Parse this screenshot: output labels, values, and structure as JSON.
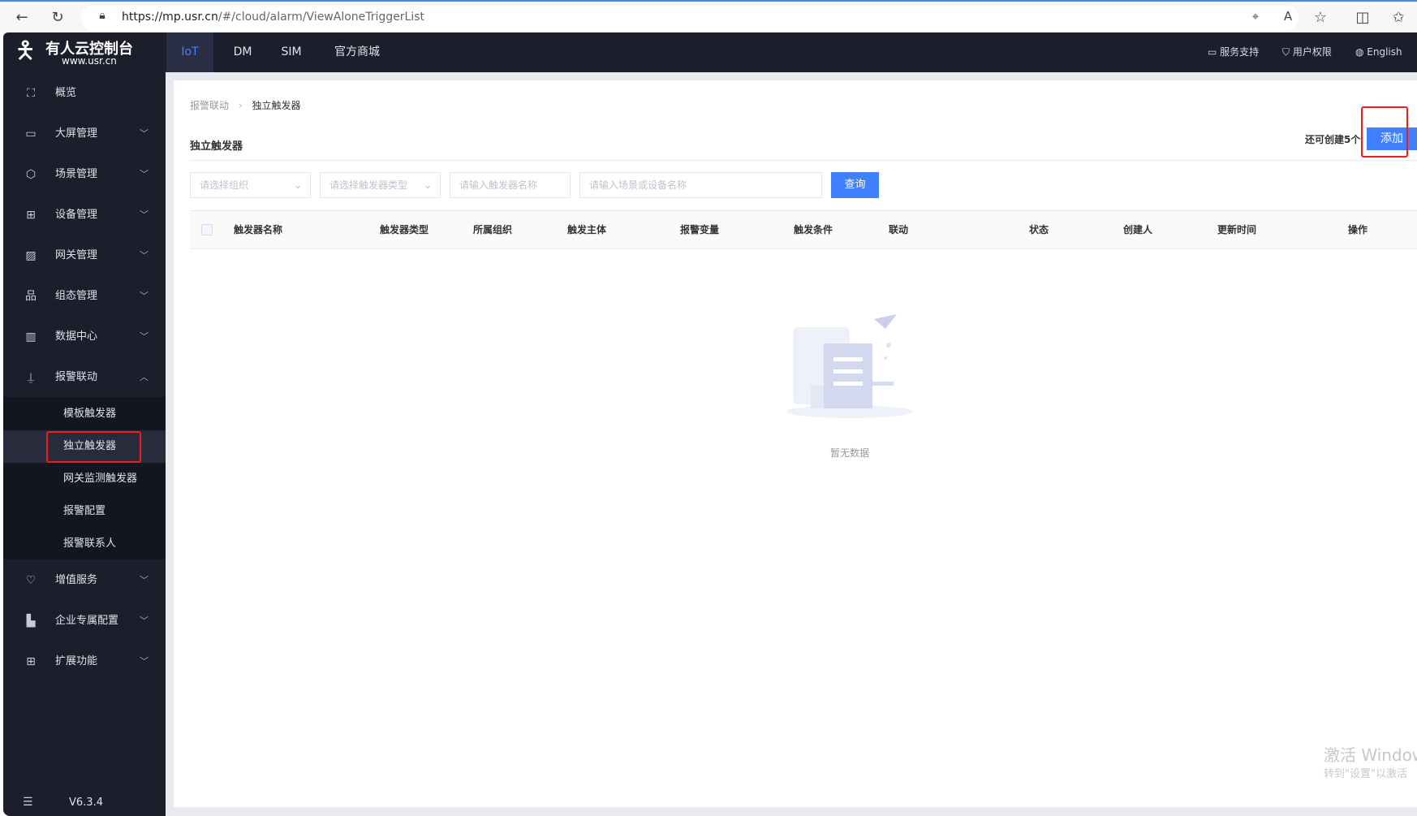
{
  "browser": {
    "url_host": "https://mp.usr.cn",
    "url_path": "/#/cloud/alarm/ViewAloneTriggerList",
    "icons": [
      "back-icon",
      "reload-icon",
      "lock-icon",
      "location-icon",
      "read-aloud-icon",
      "favorite-icon",
      "split-screen-icon",
      "favorites-list-icon"
    ]
  },
  "logo": {
    "title": "有人云控制台",
    "subtitle": "www.usr.cn"
  },
  "topnav": {
    "tabs": [
      "IoT",
      "DM",
      "SIM",
      "官方商城"
    ],
    "right": [
      "服务支持",
      "用户权限",
      "English"
    ]
  },
  "sidebar": {
    "items": [
      {
        "label": "概览",
        "icon": "overview-icon"
      },
      {
        "label": "大屏管理",
        "icon": "screen-icon"
      },
      {
        "label": "场景管理",
        "icon": "scene-icon"
      },
      {
        "label": "设备管理",
        "icon": "device-icon"
      },
      {
        "label": "网关管理",
        "icon": "gateway-icon"
      },
      {
        "label": "组态管理",
        "icon": "config-icon"
      },
      {
        "label": "数据中心",
        "icon": "data-icon"
      },
      {
        "label": "报警联动",
        "icon": "alarm-icon"
      }
    ],
    "submenu": [
      "模板触发器",
      "独立触发器",
      "网关监测触发器",
      "报警配置",
      "报警联系人"
    ],
    "items2": [
      {
        "label": "增值服务",
        "icon": "diamond-icon"
      },
      {
        "label": "企业专属配置",
        "icon": "building-icon"
      },
      {
        "label": "扩展功能",
        "icon": "apps-icon"
      }
    ],
    "version": "V6.3.4"
  },
  "breadcrumb": [
    "报警联动",
    "独立触发器"
  ],
  "page_title": "独立触发器",
  "remaining": "还可创建5个",
  "add_button": "添加",
  "filters": {
    "org": "请选择组织",
    "type": "请选择触发器类型",
    "name": "请输入触发器名称",
    "scene": "请输入场景或设备名称",
    "query": "查询"
  },
  "table": {
    "columns": [
      "触发器名称",
      "触发器类型",
      "所属组织",
      "触发主体",
      "报警变量",
      "触发条件",
      "联动",
      "状态",
      "创建人",
      "更新时间",
      "操作"
    ],
    "rows": []
  },
  "empty_text": "暂无数据",
  "watermark": {
    "line1": "激活 Windows",
    "line2": "转到\"设置\"以激活"
  },
  "colors": {
    "primary": "#4080ff",
    "sidebar": "#1c1f2b",
    "highlight": "#f01d1d"
  }
}
